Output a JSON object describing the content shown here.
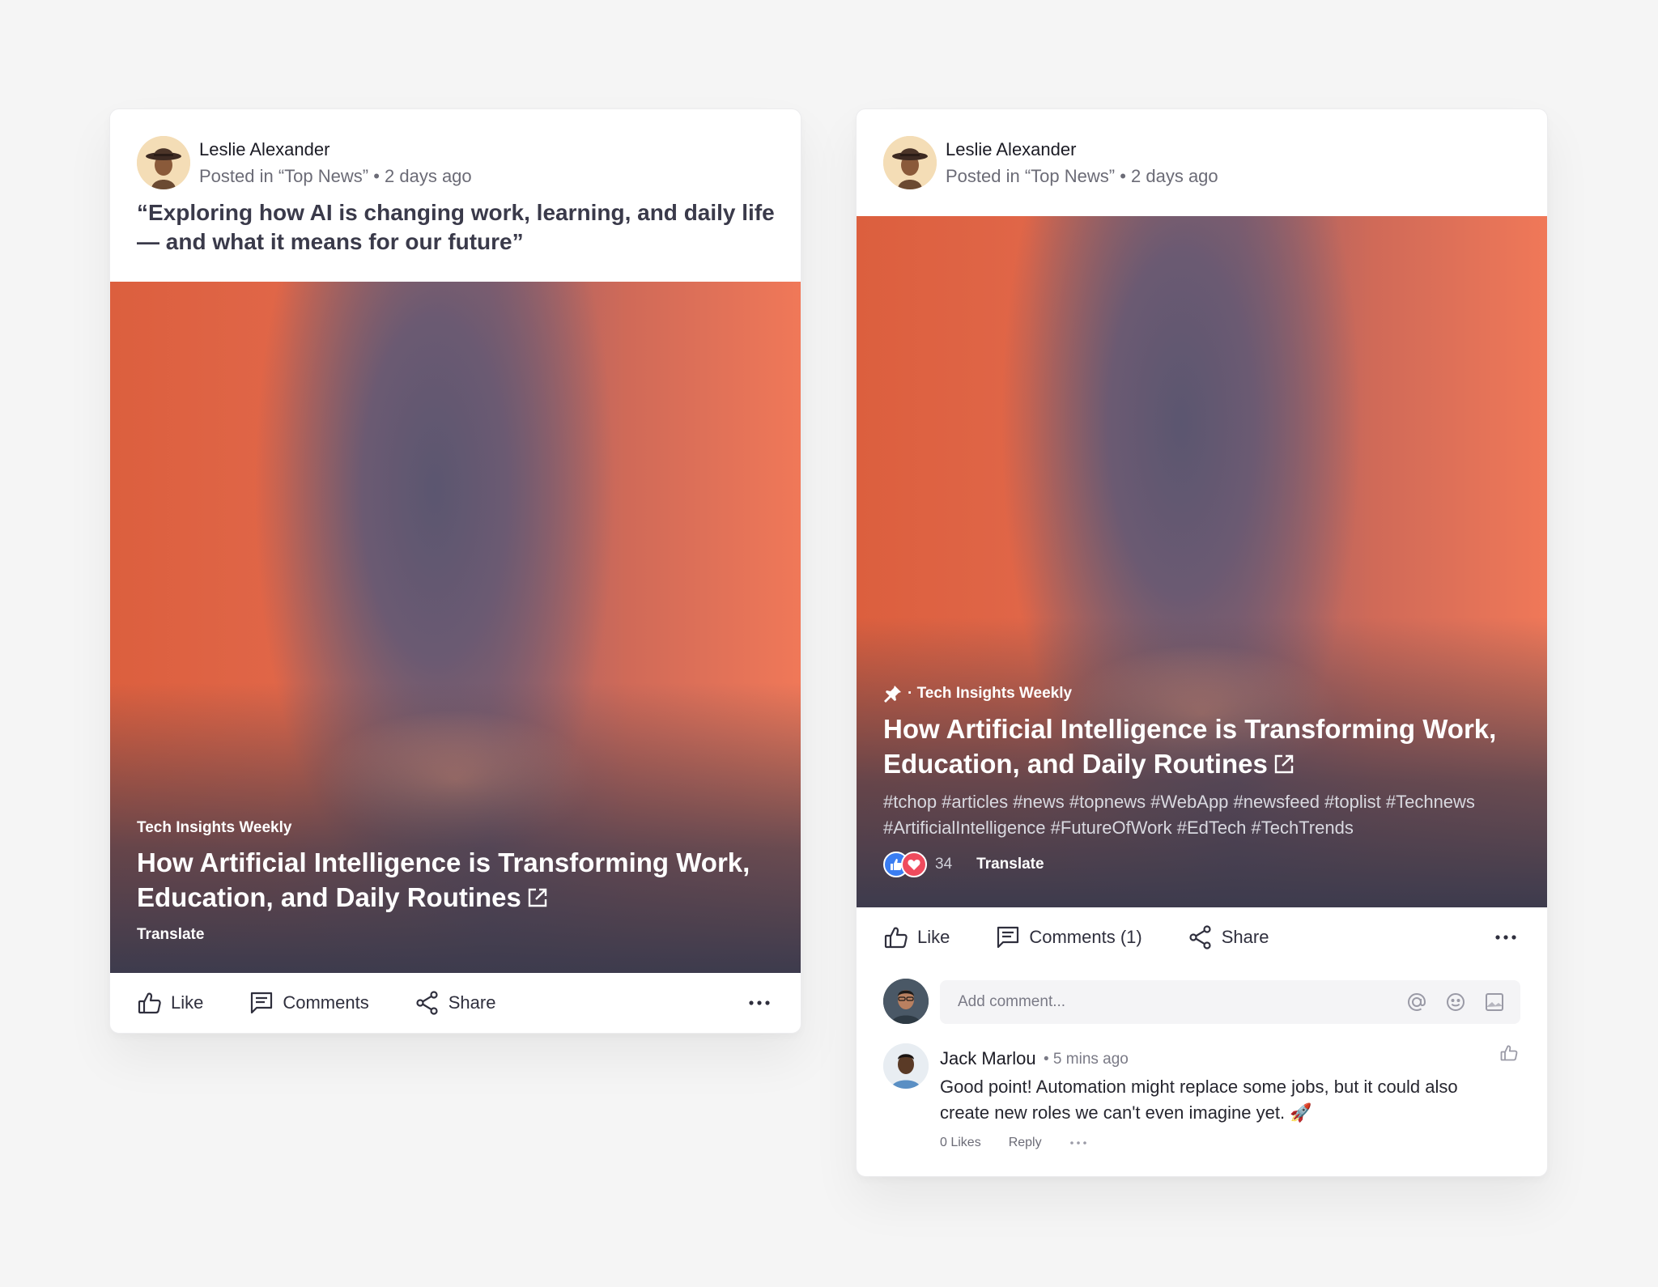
{
  "post_one": {
    "author": "Leslie Alexander",
    "meta": "Posted in “Top News” • 2 days ago",
    "quote": "“Exploring how AI is changing work, learning, and daily life — and what it means for our future”",
    "source": "Tech Insights Weekly",
    "title": "How Artificial Intelligence is Transforming Work, Education, and Daily Routines",
    "translate": "Translate",
    "actions": {
      "like": "Like",
      "comments": "Comments",
      "share": "Share"
    }
  },
  "post_two": {
    "author": "Leslie Alexander",
    "meta": "Posted in “Top News” • 2 days ago",
    "source": "· Tech Insights Weekly",
    "title": "How Artificial Intelligence is Transforming Work, Education, and Daily Routines",
    "hashtags": "#tchop #articles #news #topnews #WebApp #newsfeed #toplist #Technews #ArtificialIntelligence #FutureOfWork #EdTech #TechTrends",
    "reaction_count": "34",
    "translate": "Translate",
    "actions": {
      "like": "Like",
      "comments": "Comments (1)",
      "share": "Share"
    },
    "comment_input": {
      "placeholder": "Add comment..."
    },
    "comment": {
      "author": "Jack Marlou",
      "time": "• 5 mins ago",
      "text": "Good point! Automation might replace some jobs, but it could also create new roles we can't even imagine yet. 🚀",
      "likes": "0 Likes",
      "reply": "Reply"
    }
  },
  "icons": {
    "like": "thumbs-up-icon",
    "comments": "comment-icon",
    "share": "share-icon",
    "more": "more-horizontal-icon",
    "external": "external-link-icon",
    "pin": "pin-icon",
    "mention": "at-sign-icon",
    "emoji": "smiley-icon",
    "image": "image-icon"
  },
  "colors": {
    "background": "#f5f5f5",
    "card": "#ffffff",
    "like_reaction": "#3a7df2",
    "love_reaction": "#ef4b5d",
    "hero_orange": "#f07858",
    "hero_dark": "#3d3b4d"
  }
}
